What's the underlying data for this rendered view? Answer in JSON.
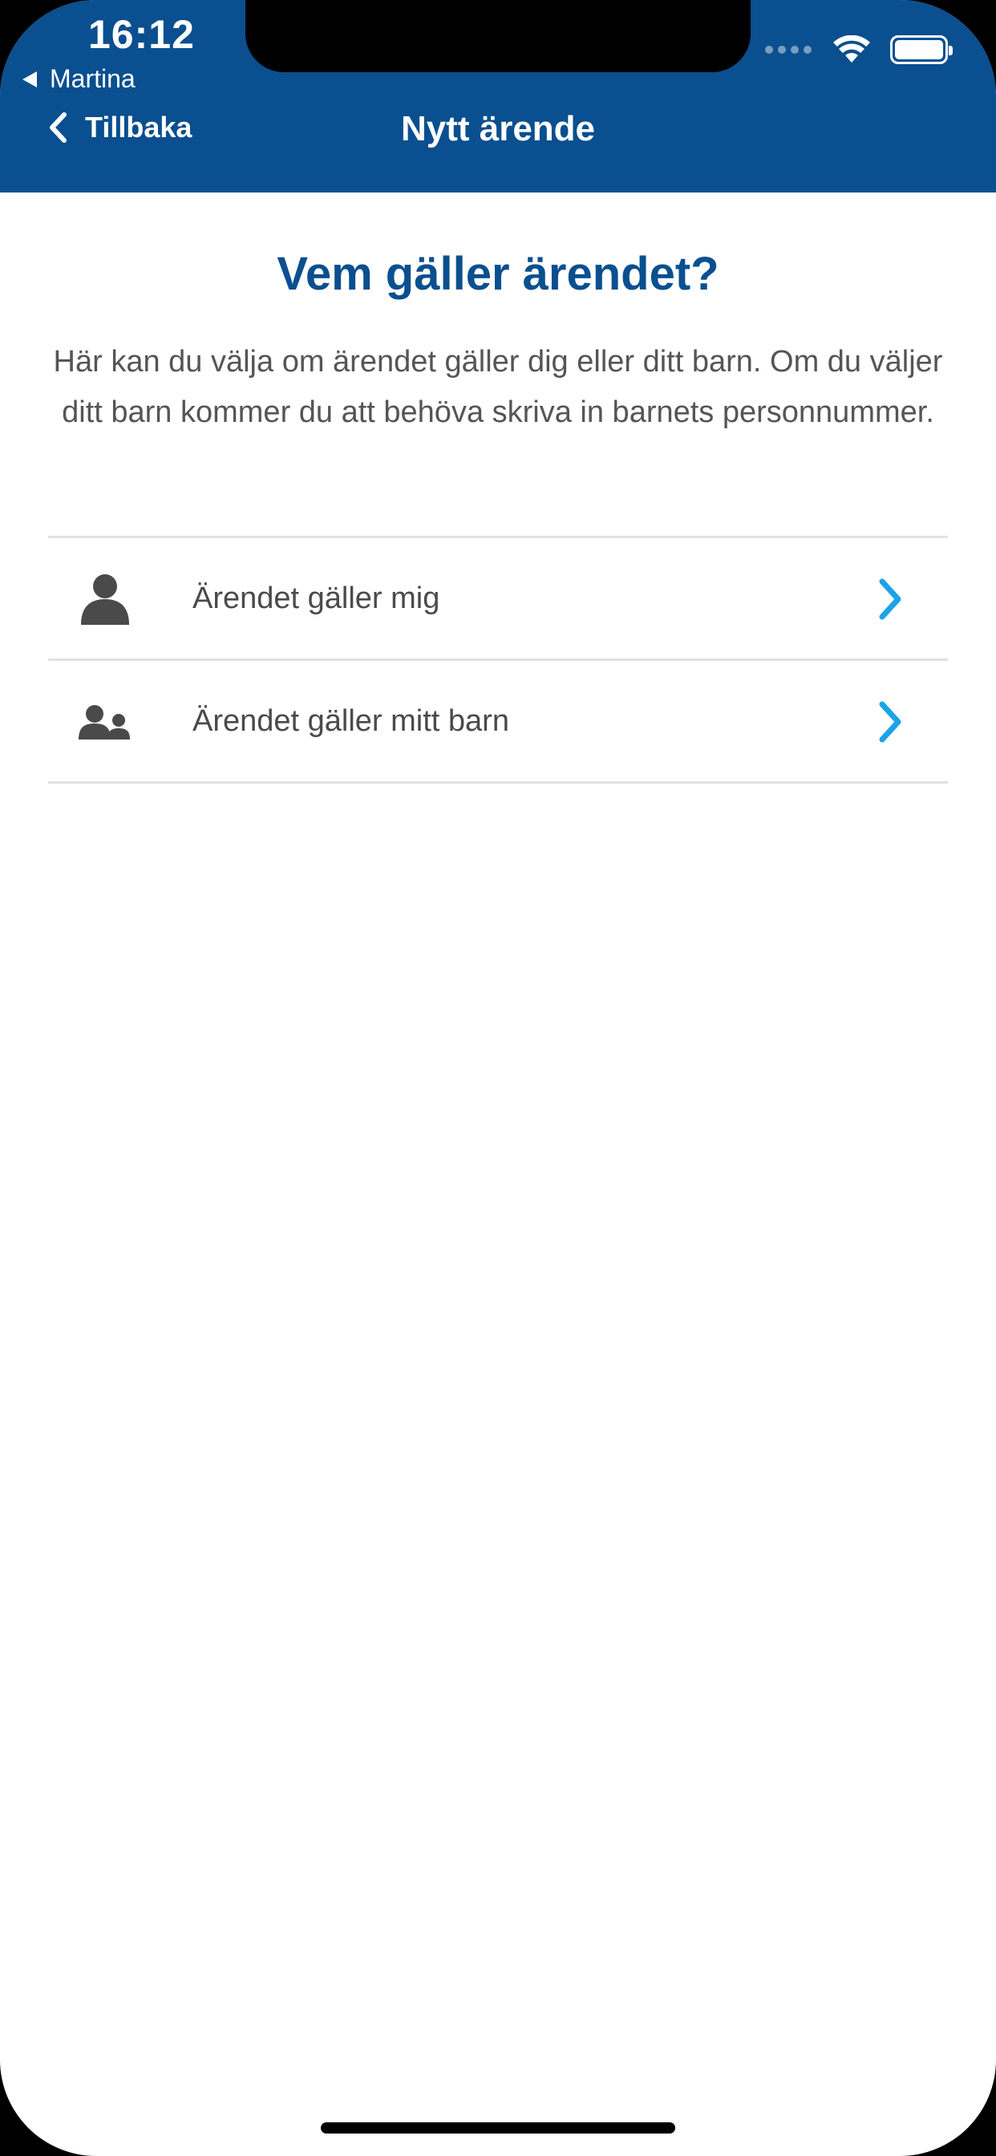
{
  "status_bar": {
    "time": "16:12",
    "back_app_label": "Martina"
  },
  "nav": {
    "back_label": "Tillbaka",
    "title": "Nytt ärende"
  },
  "content": {
    "title": "Vem gäller ärendet?",
    "description": "Här kan du välja om ärendet gäller dig eller ditt barn. Om du väljer ditt barn kommer du att behöva skriva in barnets personnummer."
  },
  "options": [
    {
      "label": "Ärendet gäller mig",
      "icon": "person-icon"
    },
    {
      "label": "Ärendet gäller mitt barn",
      "icon": "parent-child-icon"
    }
  ],
  "colors": {
    "header_bg": "#0a4f8f",
    "title_color": "#0a4f8f",
    "chevron_color": "#1aa3e8",
    "icon_color": "#4a4a4a"
  }
}
